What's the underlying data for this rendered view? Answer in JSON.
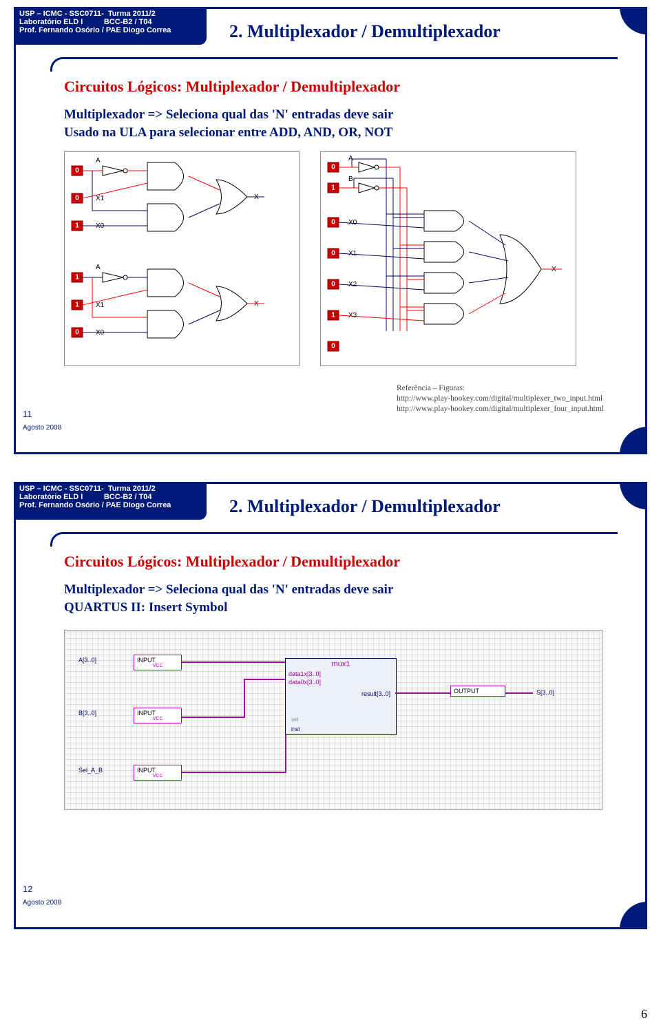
{
  "page_number_bottom": "6",
  "header": {
    "line1a": "USP – ICMC - SSC0711-",
    "line1b": "Turma 2011/2",
    "line2a": "Laboratório ELD I",
    "line2b": "BCC-B2 / T04",
    "line3": "Prof.  Fernando Osório / PAE Diogo Correa"
  },
  "slide11": {
    "num": "11",
    "date": "Agosto 2008",
    "title": "2. Multiplexador / Demultiplexador",
    "content_title": "Circuitos Lógicos: Multiplexador / Demultiplexador",
    "line1": "Multiplexador => Seleciona qual das 'N' entradas deve sair",
    "line2": "Usado na ULA para selecionar entre ADD, AND, OR, NOT",
    "ref_title": "Referência – Figuras:",
    "ref1": "http://www.play-hookey.com/digital/multiplexer_two_input.html",
    "ref2": "http://www.play-hookey.com/digital/multiplexer_four_input.html",
    "two_mux": {
      "pins": [
        "0",
        "0",
        "1",
        "1",
        "1",
        "0"
      ],
      "labels": [
        "A",
        "X1",
        "X0",
        "A",
        "X1",
        "X0",
        "X"
      ]
    },
    "four_mux": {
      "pins": [
        "0",
        "1",
        "0",
        "0",
        "0",
        "1",
        "0"
      ],
      "labels": [
        "A",
        "B",
        "X0",
        "X1",
        "X2",
        "X3",
        "X"
      ]
    }
  },
  "slide12": {
    "num": "12",
    "date": "Agosto 2008",
    "title": "2. Multiplexador / Demultiplexador",
    "content_title": "Circuitos Lógicos: Multiplexador / Demultiplexador",
    "line1": "Multiplexador => Seleciona qual das 'N' entradas deve sair",
    "line2": "QUARTUS II:   Insert Symbol",
    "pins": {
      "a": "A[3..0]",
      "b": "B[3..0]",
      "sel": "Sel_A_B",
      "input": "INPUT",
      "vcc": "VCC",
      "output": "OUTPUT",
      "s": "S[3..0]"
    },
    "mux": {
      "name": "mux1",
      "p1": "data1x[3..0]",
      "p2": "data0x[3..0]",
      "p3": "sel",
      "out": "result[3..0]",
      "inst": "inst"
    }
  }
}
